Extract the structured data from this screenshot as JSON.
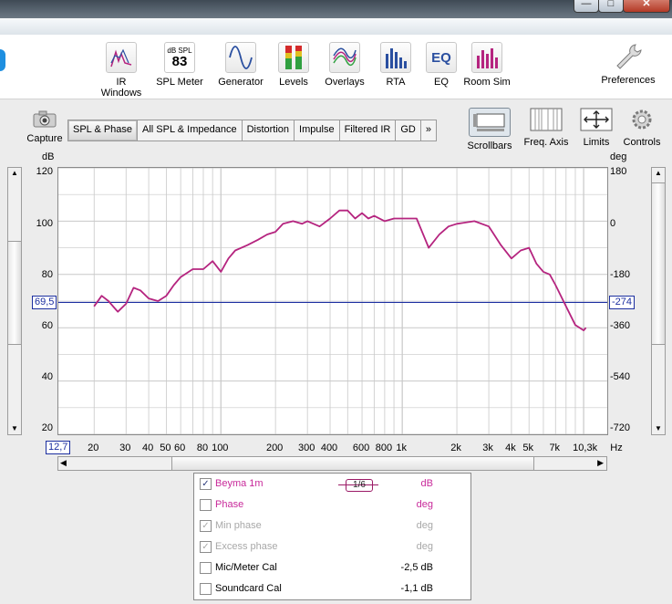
{
  "window": {
    "min_glyph": "—",
    "max_glyph": "□",
    "close_glyph": "✕"
  },
  "toolbar": [
    {
      "label": "IR Windows",
      "icon": "ir-windows-icon"
    },
    {
      "label": "SPL Meter",
      "icon": "spl-meter-icon",
      "meter_caption": "dB SPL",
      "meter_value": "83"
    },
    {
      "label": "Generator",
      "icon": "generator-icon"
    },
    {
      "label": "Levels",
      "icon": "levels-icon"
    },
    {
      "label": "Overlays",
      "icon": "overlays-icon"
    },
    {
      "label": "RTA",
      "icon": "rta-icon"
    },
    {
      "label": "EQ",
      "icon": "eq-icon"
    },
    {
      "label": "Room Sim",
      "icon": "room-sim-icon"
    },
    {
      "label": "Preferences",
      "icon": "wrench-icon"
    }
  ],
  "capture_label": "Capture",
  "tabs": [
    "SPL & Phase",
    "All SPL & Impedance",
    "Distortion",
    "Impulse",
    "Filtered IR",
    "GD",
    "»"
  ],
  "right_buttons": [
    "Scrollbars",
    "Freq. Axis",
    "Limits",
    "Controls"
  ],
  "plot": {
    "left_unit": "dB",
    "right_unit": "deg",
    "left_ticks": [
      "120",
      "100",
      "80",
      "60",
      "40",
      "20"
    ],
    "right_ticks": [
      "180",
      "0",
      "-180",
      "-360",
      "-540",
      "-720"
    ],
    "cursor_left": "69,5",
    "cursor_right": "-274",
    "x_start_box": "12,7",
    "x_ticks": [
      "20",
      "30",
      "40",
      "50",
      "60",
      "80",
      "100",
      "200",
      "300",
      "400",
      "600",
      "800",
      "1k",
      "2k",
      "3k",
      "4k",
      "5k",
      "7k",
      "10,3k",
      "Hz"
    ],
    "colors": {
      "trace": "#b5247f",
      "cursor": "#1c2fa0",
      "grid": "#c8c8c8"
    }
  },
  "chart_data": {
    "type": "line",
    "x_scale": "log",
    "xlim": [
      12.7,
      13500
    ],
    "ylim": [
      20,
      120
    ],
    "x_ticks": [
      20,
      30,
      40,
      50,
      60,
      80,
      100,
      200,
      300,
      400,
      600,
      800,
      1000,
      2000,
      3000,
      4000,
      5000,
      7000,
      10300
    ],
    "series": [
      {
        "name": "Beyma 1m",
        "x": [
          20,
          22,
          24,
          27,
          30,
          33,
          36,
          40,
          45,
          50,
          55,
          60,
          70,
          80,
          90,
          100,
          110,
          120,
          140,
          160,
          180,
          200,
          220,
          250,
          280,
          300,
          350,
          400,
          450,
          500,
          550,
          600,
          650,
          700,
          800,
          900,
          1000,
          1100,
          1200,
          1400,
          1600,
          1800,
          2000,
          2500,
          3000,
          3500,
          4000,
          4500,
          5000,
          5500,
          6000,
          6500,
          7000,
          8000,
          9000,
          10000,
          10300
        ],
        "y": [
          68,
          72,
          70,
          66,
          69,
          75,
          74,
          71,
          70,
          72,
          76,
          79,
          82,
          82,
          85,
          81,
          86,
          89,
          91,
          93,
          95,
          96,
          99,
          100,
          99,
          100,
          98,
          101,
          104,
          104,
          101,
          103,
          101,
          102,
          100,
          101,
          101,
          101,
          101,
          90,
          95,
          98,
          99,
          100,
          98,
          91,
          86,
          89,
          90,
          84,
          81,
          80,
          76,
          68,
          61,
          59,
          60
        ]
      }
    ],
    "cursor": {
      "y": 69.5,
      "phase": -274
    },
    "grid": true
  },
  "legend": [
    {
      "label": "Beyma 1m",
      "unit": "dB",
      "checked": "✓",
      "smoothing": "1/6",
      "style": "pink"
    },
    {
      "label": "Phase",
      "unit": "deg",
      "checked": "",
      "style": "pink"
    },
    {
      "label": "Min phase",
      "unit": "deg",
      "checked": "✓",
      "style": "dim"
    },
    {
      "label": "Excess phase",
      "unit": "deg",
      "checked": "✓",
      "style": "dim"
    },
    {
      "label": "Mic/Meter Cal",
      "unit": "-2,5 dB",
      "checked": "",
      "style": "normal"
    },
    {
      "label": "Soundcard Cal",
      "unit": "-1,1 dB",
      "checked": "",
      "style": "normal"
    }
  ]
}
